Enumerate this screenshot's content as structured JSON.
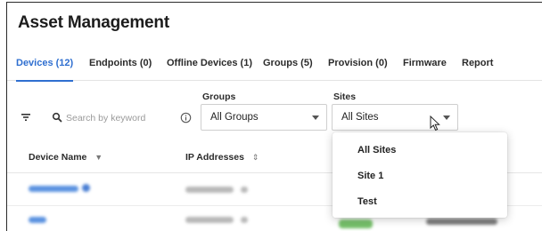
{
  "app": {
    "title": "Asset Management"
  },
  "tabs": [
    {
      "label": "Devices (12)",
      "active": true
    },
    {
      "label": "Endpoints (0)",
      "active": false
    },
    {
      "label": "Offline Devices (1)",
      "active": false
    },
    {
      "label": "Groups (5)",
      "active": false
    },
    {
      "label": "Provision (0)",
      "active": false
    },
    {
      "label": "Firmware",
      "active": false
    },
    {
      "label": "Report",
      "active": false
    }
  ],
  "toolbar": {
    "filter_icon": "filter-icon",
    "search_placeholder": "Search by keyword",
    "search_value": "",
    "search_icon": "search-icon",
    "info_icon": "info-icon"
  },
  "filters": {
    "groups": {
      "label": "Groups",
      "selected": "All Groups"
    },
    "sites": {
      "label": "Sites",
      "selected": "All Sites",
      "open": true,
      "options": [
        "All Sites",
        "Site 1",
        "Test"
      ]
    }
  },
  "table": {
    "columns": [
      {
        "label": "Device Name",
        "sort_icon": "chevron-down-icon"
      },
      {
        "label": "IP Addresses",
        "sort_icon": "sort-icon"
      }
    ]
  },
  "colors": {
    "accent": "#2f6fd0",
    "text": "#1f1f1f",
    "border": "#cfcfcf"
  }
}
